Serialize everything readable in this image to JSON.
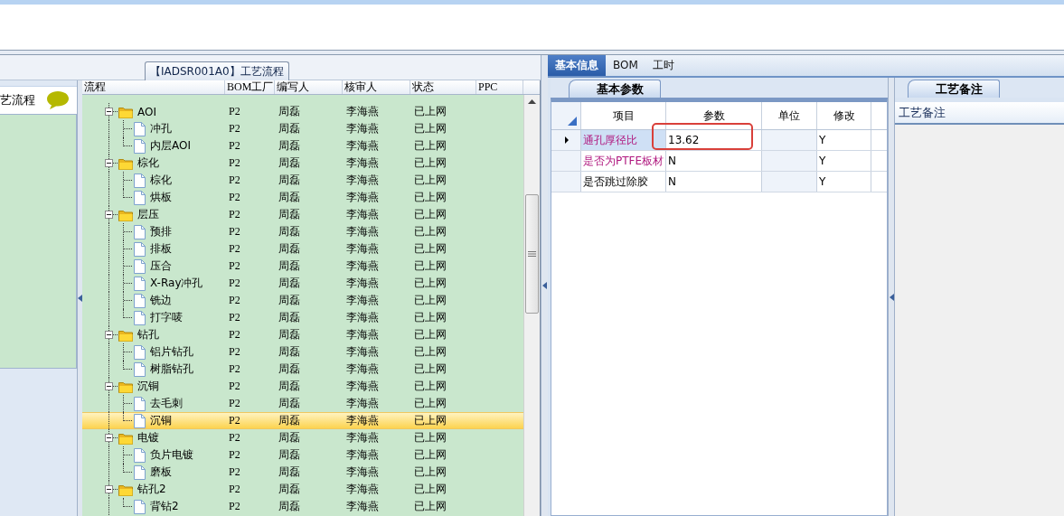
{
  "top_title_tab": "【IADSR001A0】工艺流程",
  "left_panel": {
    "title": "艺流程"
  },
  "flow_grid": {
    "columns": [
      "流程",
      "BOM工厂",
      "编写人",
      "核审人",
      "状态",
      "PPC"
    ],
    "rows": [
      {
        "name": "AOI",
        "bom": "P2",
        "writer": "周磊",
        "reviewer": "李海燕",
        "status": "已上网",
        "expanded": true,
        "selected": false,
        "children": [
          {
            "name": "冲孔",
            "bom": "P2",
            "writer": "周磊",
            "reviewer": "李海燕",
            "status": "已上网",
            "selected": false
          },
          {
            "name": "内层AOI",
            "bom": "P2",
            "writer": "周磊",
            "reviewer": "李海燕",
            "status": "已上网",
            "selected": false
          }
        ]
      },
      {
        "name": "棕化",
        "bom": "P2",
        "writer": "周磊",
        "reviewer": "李海燕",
        "status": "已上网",
        "expanded": true,
        "selected": false,
        "children": [
          {
            "name": "棕化",
            "bom": "P2",
            "writer": "周磊",
            "reviewer": "李海燕",
            "status": "已上网",
            "selected": false
          },
          {
            "name": "烘板",
            "bom": "P2",
            "writer": "周磊",
            "reviewer": "李海燕",
            "status": "已上网",
            "selected": false
          }
        ]
      },
      {
        "name": "层压",
        "bom": "P2",
        "writer": "周磊",
        "reviewer": "李海燕",
        "status": "已上网",
        "expanded": true,
        "selected": false,
        "children": [
          {
            "name": "预排",
            "bom": "P2",
            "writer": "周磊",
            "reviewer": "李海燕",
            "status": "已上网",
            "selected": false
          },
          {
            "name": "排板",
            "bom": "P2",
            "writer": "周磊",
            "reviewer": "李海燕",
            "status": "已上网",
            "selected": false
          },
          {
            "name": "压合",
            "bom": "P2",
            "writer": "周磊",
            "reviewer": "李海燕",
            "status": "已上网",
            "selected": false
          },
          {
            "name": "X-Ray冲孔",
            "bom": "P2",
            "writer": "周磊",
            "reviewer": "李海燕",
            "status": "已上网",
            "selected": false
          },
          {
            "name": "铣边",
            "bom": "P2",
            "writer": "周磊",
            "reviewer": "李海燕",
            "status": "已上网",
            "selected": false
          },
          {
            "name": "打字唛",
            "bom": "P2",
            "writer": "周磊",
            "reviewer": "李海燕",
            "status": "已上网",
            "selected": false
          }
        ]
      },
      {
        "name": "钻孔",
        "bom": "P2",
        "writer": "周磊",
        "reviewer": "李海燕",
        "status": "已上网",
        "expanded": true,
        "selected": false,
        "children": [
          {
            "name": "铝片钻孔",
            "bom": "P2",
            "writer": "周磊",
            "reviewer": "李海燕",
            "status": "已上网",
            "selected": false
          },
          {
            "name": "树脂钻孔",
            "bom": "P2",
            "writer": "周磊",
            "reviewer": "李海燕",
            "status": "已上网",
            "selected": false
          }
        ]
      },
      {
        "name": "沉铜",
        "bom": "P2",
        "writer": "周磊",
        "reviewer": "李海燕",
        "status": "已上网",
        "expanded": true,
        "selected": false,
        "children": [
          {
            "name": "去毛刺",
            "bom": "P2",
            "writer": "周磊",
            "reviewer": "李海燕",
            "status": "已上网",
            "selected": false
          },
          {
            "name": "沉铜",
            "bom": "P2",
            "writer": "周磊",
            "reviewer": "李海燕",
            "status": "已上网",
            "selected": true
          }
        ]
      },
      {
        "name": "电镀",
        "bom": "P2",
        "writer": "周磊",
        "reviewer": "李海燕",
        "status": "已上网",
        "expanded": true,
        "selected": false,
        "children": [
          {
            "name": "负片电镀",
            "bom": "P2",
            "writer": "周磊",
            "reviewer": "李海燕",
            "status": "已上网",
            "selected": false
          },
          {
            "name": "磨板",
            "bom": "P2",
            "writer": "周磊",
            "reviewer": "李海燕",
            "status": "已上网",
            "selected": false
          }
        ]
      },
      {
        "name": "钻孔2",
        "bom": "P2",
        "writer": "周磊",
        "reviewer": "李海燕",
        "status": "已上网",
        "expanded": true,
        "selected": false,
        "children": [
          {
            "name": "背钻2",
            "bom": "P2",
            "writer": "周磊",
            "reviewer": "李海燕",
            "status": "已上网",
            "selected": false
          }
        ]
      }
    ]
  },
  "detail_tabs": [
    {
      "label": "基本信息",
      "selected": true
    },
    {
      "label": "BOM",
      "selected": false
    },
    {
      "label": "工时",
      "selected": false
    }
  ],
  "params_panel": {
    "tab": "基本参数",
    "columns": [
      "项目",
      "参数",
      "单位",
      "修改"
    ],
    "rows": [
      {
        "item": "通孔厚径比",
        "value": "13.62",
        "modify": "Y",
        "highlighted": true,
        "current": true,
        "selected": true,
        "annotated": true
      },
      {
        "item": "是否为PTFE板材",
        "value": "N",
        "modify": "Y",
        "highlighted": true,
        "current": false,
        "selected": false,
        "annotated": false
      },
      {
        "item": "是否跳过除胶",
        "value": "N",
        "modify": "Y",
        "highlighted": false,
        "current": false,
        "selected": false,
        "annotated": false
      }
    ]
  },
  "notes_panel": {
    "tab": "工艺备注",
    "header": "工艺备注"
  }
}
